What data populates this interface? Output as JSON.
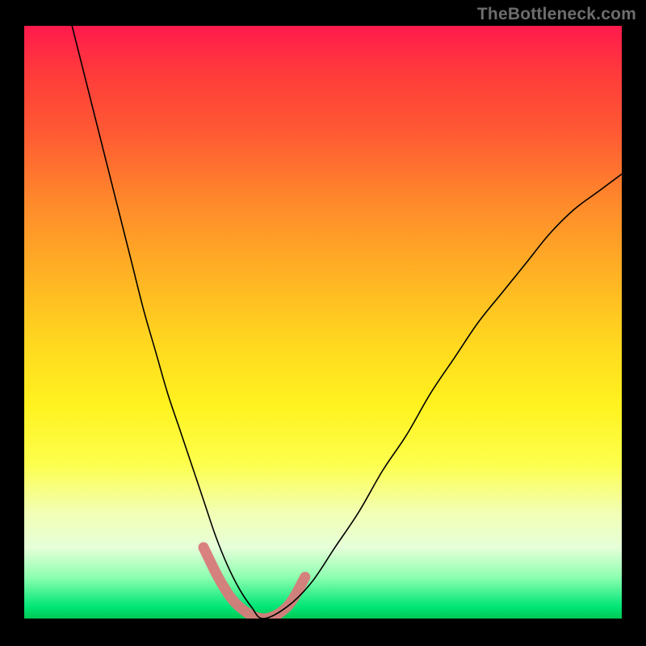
{
  "watermark": "TheBottleneck.com",
  "chart_data": {
    "type": "line",
    "title": "",
    "xlabel": "",
    "ylabel": "",
    "xlim": [
      0,
      100
    ],
    "ylim": [
      0,
      100
    ],
    "grid": false,
    "legend": false,
    "series": [
      {
        "name": "bottleneck-curve",
        "x": [
          8,
          10,
          12,
          14,
          16,
          18,
          20,
          22,
          24,
          26,
          28,
          30,
          32,
          34,
          36,
          38,
          40,
          44,
          48,
          52,
          56,
          60,
          64,
          68,
          72,
          76,
          80,
          84,
          88,
          92,
          96,
          100
        ],
        "y": [
          100,
          92,
          84,
          76,
          68,
          60,
          52,
          45,
          38,
          32,
          26,
          20,
          14,
          9,
          5,
          2,
          0,
          2,
          6,
          12,
          18,
          25,
          31,
          38,
          44,
          50,
          55,
          60,
          65,
          69,
          72,
          75
        ]
      }
    ],
    "highlight": {
      "name": "near-bottom-band",
      "x": [
        30,
        33,
        36,
        40,
        44,
        47
      ],
      "y": [
        12,
        6,
        2,
        0,
        2,
        7
      ]
    }
  }
}
